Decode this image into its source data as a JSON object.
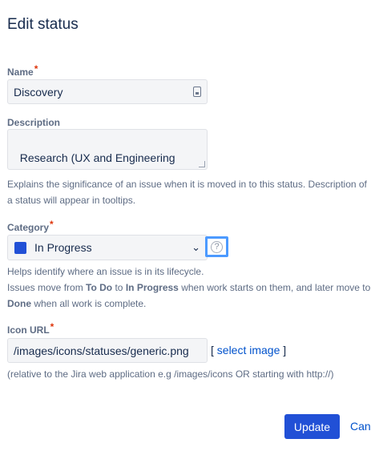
{
  "dialog": {
    "title": "Edit status"
  },
  "name": {
    "label": "Name",
    "required": "*",
    "value": "Discovery"
  },
  "description": {
    "label": "Description",
    "value": "Research (UX and Engineering\nResearch spikes) being done",
    "help": "Explains the significance of an issue when it is moved in to this status. Description of",
    "help2": "a status will appear in tooltips."
  },
  "category": {
    "label": "Category",
    "required": "*",
    "value": "In Progress",
    "swatch_color": "#2150d6",
    "chevron_icon": "chevron-down-icon",
    "help_icon": "question-circle-icon",
    "help_line1": "Helps identify where an issue is in its lifecycle.",
    "help_line2_a": "Issues move from ",
    "help_line2_b": "To Do",
    "help_line2_c": " to ",
    "help_line2_d": "In Progress",
    "help_line2_e": " when work starts on them, and later move to",
    "help_line3_a": "Done",
    "help_line3_b": " when all work is complete."
  },
  "icon_url": {
    "label": "Icon URL",
    "required": "*",
    "value": "/images/icons/statuses/generic.png",
    "select_open": "[",
    "select_link": "select image",
    "select_close": "]",
    "help": "(relative to the Jira web application e.g /images/icons OR starting with http://)"
  },
  "actions": {
    "update": "Update",
    "cancel": "Cancel"
  },
  "colors": {
    "primary": "#2150d6",
    "link": "#0052cc",
    "required": "#de350b",
    "focus": "#4c9aff"
  }
}
